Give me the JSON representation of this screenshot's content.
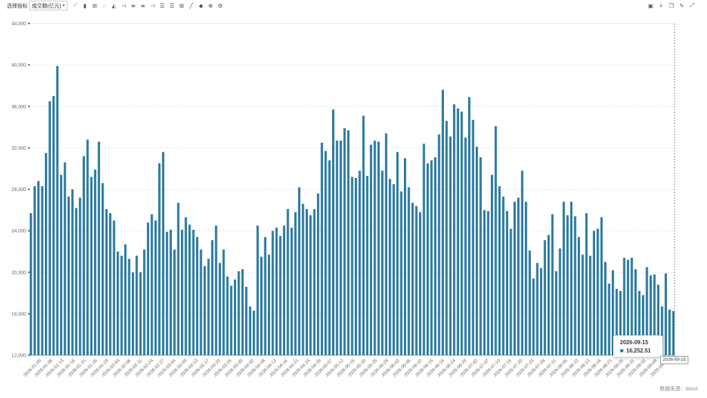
{
  "toolbar": {
    "label": "选择指标",
    "select_value": "成交额(亿元)",
    "left_icons": [
      "line-chart-icon",
      "bar-compare-icon",
      "indicator-icon",
      "scatter-icon",
      "area-icon",
      "insert-icon",
      "align-icon",
      "align-icon",
      "insert-icon",
      "list-icon",
      "list-icon",
      "grid-icon",
      "draw-line-icon",
      "fill-icon",
      "zoom-icon",
      "settings-icon"
    ],
    "right_icons": [
      "export-image-icon",
      "download-icon",
      "copy-icon",
      "edit-icon",
      "fullscreen-icon"
    ]
  },
  "footnote": "数据来源：Wind",
  "tooltip": {
    "date": "2026-09-15",
    "value": "16,252.51"
  },
  "colors": {
    "bar": "#2a7aa0",
    "grid": "#e6e6e6",
    "axis_text": "#666666"
  },
  "chart_data": {
    "type": "bar",
    "title": "",
    "xlabel": "",
    "ylabel": "",
    "ylim": [
      12000,
      44000
    ],
    "yticks": [
      12000,
      16000,
      20000,
      24000,
      28000,
      32000,
      36000,
      40000,
      44000
    ],
    "ytick_labels": [
      "12,000",
      "16,000",
      "20,000",
      "24,000",
      "28,000",
      "32,000",
      "36,000",
      "40,000",
      "44,000"
    ],
    "xtick_labels": [
      "2026-01-05",
      "2026-01-08",
      "2026-01-13",
      "2026-01-16",
      "2026-01-21",
      "2026-01-26",
      "2026-01-29",
      "2026-02-03",
      "2026-02-06",
      "2026-02-11",
      "2026-02-24",
      "2026-02-27",
      "2026-03-04",
      "2026-03-09",
      "2026-03-12",
      "2026-03-17",
      "2026-03-20",
      "2026-03-25",
      "2026-03-30",
      "2026-04-02",
      "2026-04-08",
      "2026-04-13",
      "2026-04-16",
      "2026-04-21",
      "2026-04-24",
      "2026-04-29",
      "2026-05-07",
      "2026-05-12",
      "2026-05-15",
      "2026-05-20",
      "2026-05-25",
      "2026-05-28",
      "2026-06-02",
      "2026-06-05",
      "2026-06-10",
      "2026-06-15",
      "2026-06-18",
      "2026-06-24",
      "2026-06-29",
      "2026-07-02",
      "2026-07-07",
      "2026-07-10",
      "2026-07-15",
      "2026-07-20",
      "2026-07-23",
      "2026-07-28",
      "2026-07-31",
      "2026-08-05",
      "2026-08-10",
      "2026-08-13",
      "2026-08-18",
      "2026-08-21",
      "2026-08-26",
      "2026-08-31",
      "2026-09-03",
      "2026-09-08",
      "2026-09-11"
    ],
    "grid": true,
    "cursor_category": "2026-09-15",
    "series": [
      {
        "values": [
          25700,
          28300,
          28800,
          28300,
          31500,
          36500,
          37000,
          39900,
          29400,
          30600,
          27300,
          28000,
          26200,
          27200,
          31200,
          32800,
          29200,
          29900,
          32600,
          28600,
          26100,
          25700,
          25000,
          22000,
          21600,
          22700,
          21300,
          20000,
          21600,
          20000,
          22200,
          24800,
          25600,
          25000,
          30500,
          31600,
          23900,
          24100,
          22200,
          26700,
          24100,
          25300,
          24600,
          24100,
          23400,
          22200,
          20600,
          21300,
          23100,
          24500,
          20900,
          22200,
          19600,
          18700,
          19300,
          20100,
          20300,
          18600,
          16700,
          16300,
          24500,
          21500,
          23400,
          21700,
          24000,
          24300,
          23500,
          24500,
          26100,
          24300,
          25800,
          28200,
          26600,
          26100,
          25500,
          26100,
          27600,
          32500,
          31700,
          30800,
          35700,
          32700,
          32700,
          33900,
          33700,
          29200,
          29100,
          29800,
          35100,
          29300,
          32300,
          32700,
          32600,
          29800,
          33400,
          29000,
          28500,
          31600,
          27800,
          31000,
          28200,
          26700,
          26400,
          25800,
          32400,
          30500,
          30800,
          31100,
          33300,
          37600,
          34600,
          33100,
          36200,
          35800,
          35500,
          33000,
          36900,
          34700,
          32100,
          31100,
          26000,
          25900,
          29400,
          34100,
          28300,
          27300,
          25900,
          24200,
          26800,
          27200,
          29800,
          26800,
          22100,
          19400,
          20900,
          20400,
          23100,
          23600,
          25600,
          20100,
          22300,
          26800,
          25500,
          26800,
          25400,
          23400,
          21700,
          25700,
          21600,
          24000,
          24200,
          25300,
          21000,
          18900,
          20200,
          18400,
          18200,
          21400,
          21200,
          21400,
          20300,
          18200,
          17800,
          20500,
          19700,
          19800,
          18800,
          16700,
          19900,
          16400,
          16252.51
        ]
      }
    ]
  }
}
